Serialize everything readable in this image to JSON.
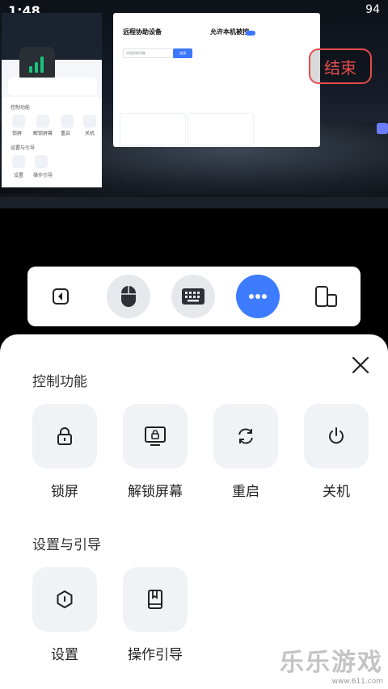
{
  "status_bar": {
    "time": "1:48",
    "right": "94"
  },
  "remote": {
    "window_left_title": "远程协助设备",
    "input_placeholder": "远程协助设备",
    "connect_label": "连接",
    "window_right_title": "允许本机被控",
    "end_button": "结束",
    "mini_panel": {
      "control_title": "控制功能",
      "items": [
        "锁屏",
        "解锁屏幕",
        "重启",
        "关机"
      ],
      "settings_title": "设置与引导",
      "settings_items": [
        "设置",
        "操作引导"
      ]
    }
  },
  "toolbar": {
    "buttons": [
      {
        "name": "back",
        "icon": "arrow-left-icon"
      },
      {
        "name": "mouse",
        "icon": "mouse-icon"
      },
      {
        "name": "keyboard",
        "icon": "keyboard-icon"
      },
      {
        "name": "more",
        "icon": "more-icon"
      },
      {
        "name": "device-switch",
        "icon": "device-switch-icon"
      }
    ]
  },
  "sheet": {
    "control_title": "控制功能",
    "control_items": [
      {
        "label": "锁屏",
        "icon": "lock-icon"
      },
      {
        "label": "解锁屏幕",
        "icon": "unlock-screen-icon"
      },
      {
        "label": "重启",
        "icon": "restart-icon"
      },
      {
        "label": "关机",
        "icon": "power-icon"
      }
    ],
    "settings_title": "设置与引导",
    "settings_items": [
      {
        "label": "设置",
        "icon": "settings-icon"
      },
      {
        "label": "操作引导",
        "icon": "guide-book-icon"
      }
    ]
  },
  "watermark": {
    "text": "乐乐游戏",
    "url": "www.611.com"
  },
  "colors": {
    "accent": "#3d7bff",
    "danger": "#e74c4c",
    "tile_bg": "#f0f2f6"
  }
}
